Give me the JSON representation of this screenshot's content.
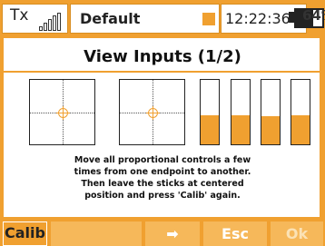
{
  "status_bar": {
    "tx_label": "Tx",
    "model_name": "Default",
    "time": "12:22:36",
    "battery_percent": "64%",
    "signal_icon": "signal-bars-icon",
    "accent_color": "#f0a030"
  },
  "screen": {
    "title": "View Inputs (1/2)",
    "instructions": [
      "Move all proportional controls a few",
      "times from one endpoint to another.",
      "Then leave the sticks at centered",
      "position and press 'Calib' again."
    ],
    "pots_fill_percent": [
      45,
      45,
      43,
      45
    ]
  },
  "softkeys": {
    "calib": "Calib",
    "arrow": "➡",
    "esc": "Esc",
    "ok": "Ok"
  }
}
